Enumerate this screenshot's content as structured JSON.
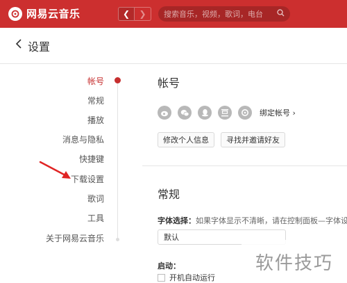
{
  "app": {
    "title": "网易云音乐",
    "brand_color": "#cc2f2f"
  },
  "search": {
    "placeholder": "搜索音乐，视频，歌词，电台"
  },
  "page": {
    "title": "设置"
  },
  "nav": {
    "items": [
      {
        "label": "帐号",
        "active": true
      },
      {
        "label": "常规"
      },
      {
        "label": "播放"
      },
      {
        "label": "消息与隐私"
      },
      {
        "label": "快捷键"
      },
      {
        "label": "下载设置"
      },
      {
        "label": "歌词"
      },
      {
        "label": "工具"
      },
      {
        "label": "关于网易云音乐"
      }
    ]
  },
  "account": {
    "title": "帐号",
    "social_icons": [
      "weibo-icon",
      "wechat-icon",
      "qq-icon",
      "douban-icon",
      "yixin-icon"
    ],
    "bind_label": "绑定帐号",
    "edit_profile_button": "修改个人信息",
    "find_friends_button": "寻找并邀请好友"
  },
  "general": {
    "title": "常规",
    "font_label": "字体选择：",
    "font_hint": "如果字体显示不清晰，请在控制面板—字体设置",
    "font_value": "默认",
    "startup_label": "启动：",
    "autostart_label": "开机自动运行"
  },
  "watermark": {
    "text": "软件技巧"
  }
}
